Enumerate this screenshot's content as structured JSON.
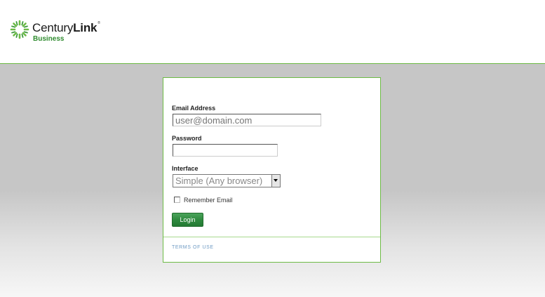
{
  "brand": {
    "name_regular": "Century",
    "name_bold": "Link",
    "trademark": "®",
    "sub": "Business",
    "accent_color": "#6dbb45",
    "sub_color": "#2e8b2e"
  },
  "form": {
    "email": {
      "label": "Email Address",
      "placeholder": "user@domain.com",
      "value": ""
    },
    "password": {
      "label": "Password",
      "value": ""
    },
    "interface": {
      "label": "Interface",
      "selected": "Simple (Any browser)"
    },
    "remember": {
      "label": "Remember Email",
      "checked": false
    },
    "login_label": "Login"
  },
  "footer": {
    "terms_label": "TERMS OF USE",
    "link_color": "#6f9bc4"
  },
  "icons": {
    "logo": "centurylink-burst-icon",
    "select_arrow": "chevron-down-icon"
  }
}
